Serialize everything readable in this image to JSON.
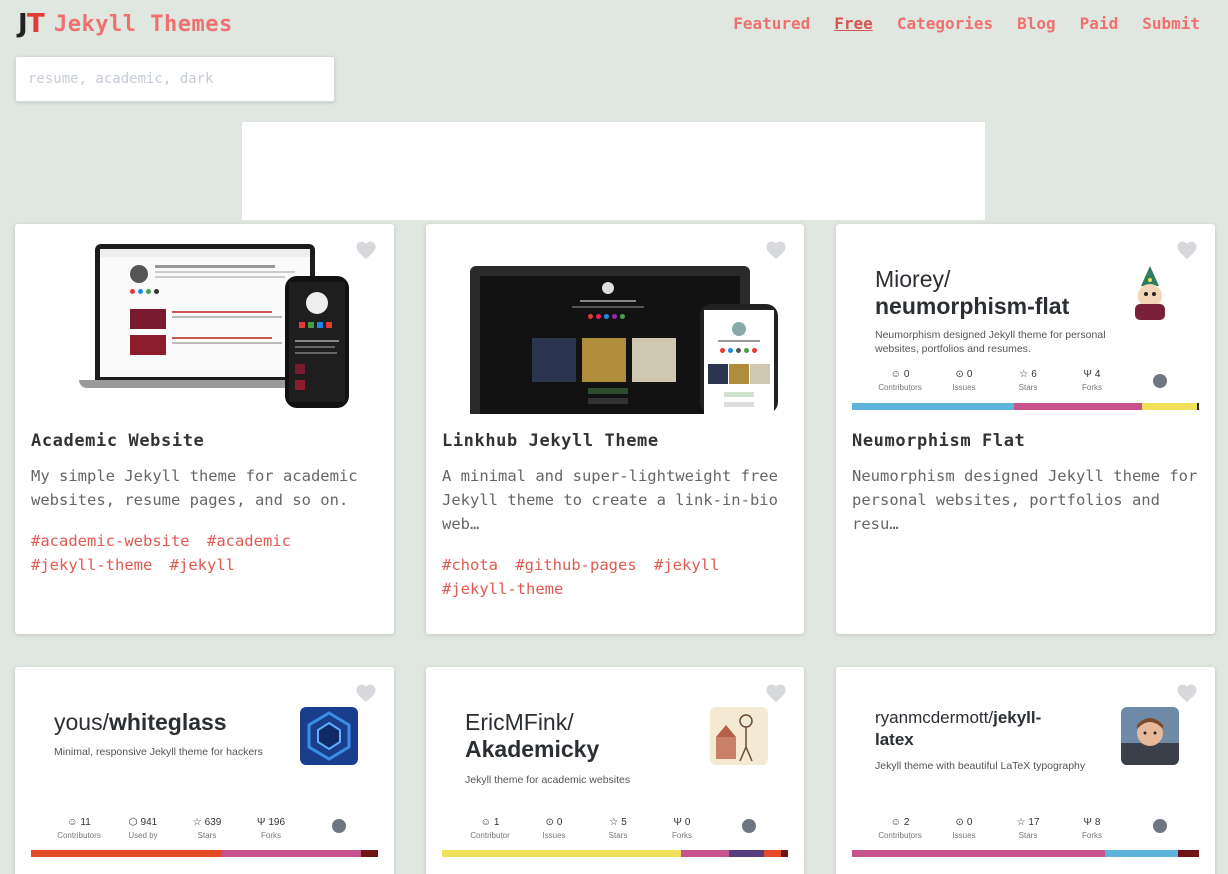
{
  "header": {
    "logo_j": "J",
    "logo_t": "T",
    "site_title": "Jekyll Themes",
    "nav": [
      {
        "label": "Featured",
        "active": false
      },
      {
        "label": "Free",
        "active": true
      },
      {
        "label": "Categories",
        "active": false
      },
      {
        "label": "Blog",
        "active": false
      },
      {
        "label": "Paid",
        "active": false
      },
      {
        "label": "Submit",
        "active": false
      }
    ]
  },
  "search": {
    "placeholder": "resume, academic, dark",
    "value": ""
  },
  "cards": [
    {
      "title": "Academic Website",
      "description": "My simple Jekyll theme for academic websites, resume pages, and so on.",
      "tags": [
        "#academic-website",
        "#academic",
        "#jekyll-theme",
        "#jekyll"
      ]
    },
    {
      "title": "Linkhub Jekyll Theme",
      "description": "A minimal and super-lightweight free Jekyll theme to create a link-in-bio web…",
      "tags": [
        "#chota",
        "#github-pages",
        "#jekyll",
        "#jekyll-theme"
      ]
    },
    {
      "title": "Neumorphism Flat",
      "description": "Neumorphism designed Jekyll theme for personal websites, portfolios and resu…",
      "tags": [],
      "repo": {
        "owner": "Miorey/",
        "name": "neumorphism-flat",
        "description": "Neumorphism designed Jekyll theme for personal websites, portfolios and resumes.",
        "stats": [
          {
            "num": "0",
            "label": "Contributors"
          },
          {
            "num": "0",
            "label": "Issues"
          },
          {
            "num": "6",
            "label": "Stars"
          },
          {
            "num": "4",
            "label": "Forks"
          }
        ],
        "languages": [
          "#5cb3dc",
          "#c6538c",
          "#f1e05a",
          "#222222"
        ]
      }
    },
    {
      "repo": {
        "owner": "yous/",
        "name": "whiteglass",
        "description": "Minimal, responsive Jekyll theme for hackers",
        "stats": [
          {
            "num": "11",
            "label": "Contributors"
          },
          {
            "num": "941",
            "label": "Used by"
          },
          {
            "num": "639",
            "label": "Stars"
          },
          {
            "num": "196",
            "label": "Forks"
          }
        ],
        "languages": [
          "#e34c26",
          "#c6538c",
          "#701516"
        ]
      }
    },
    {
      "repo": {
        "owner": "EricMFink/",
        "name": "Akademicky",
        "description": "Jekyll theme for academic websites",
        "stats": [
          {
            "num": "1",
            "label": "Contributor"
          },
          {
            "num": "0",
            "label": "Issues"
          },
          {
            "num": "5",
            "label": "Stars"
          },
          {
            "num": "0",
            "label": "Forks"
          }
        ],
        "languages": [
          "#f1e05a",
          "#c6538c",
          "#563d7c",
          "#e34c26",
          "#701516"
        ]
      }
    },
    {
      "repo": {
        "owner": "ryanmcdermott/",
        "name": "jekyll-latex",
        "description": "Jekyll theme with beautiful LaTeX typography",
        "stats": [
          {
            "num": "2",
            "label": "Contributors"
          },
          {
            "num": "0",
            "label": "Issues"
          },
          {
            "num": "17",
            "label": "Stars"
          },
          {
            "num": "8",
            "label": "Forks"
          }
        ],
        "languages": [
          "#c6538c",
          "#5cb3dc",
          "#701516"
        ]
      }
    }
  ],
  "colors": {
    "background": "#dfe7e0",
    "accent": "#f07070",
    "tag": "#e05a50",
    "heart": "#d6d8dc"
  },
  "icons": [
    "heart-icon",
    "github-icon",
    "contributors-icon",
    "issues-icon",
    "stars-icon",
    "forks-icon"
  ]
}
